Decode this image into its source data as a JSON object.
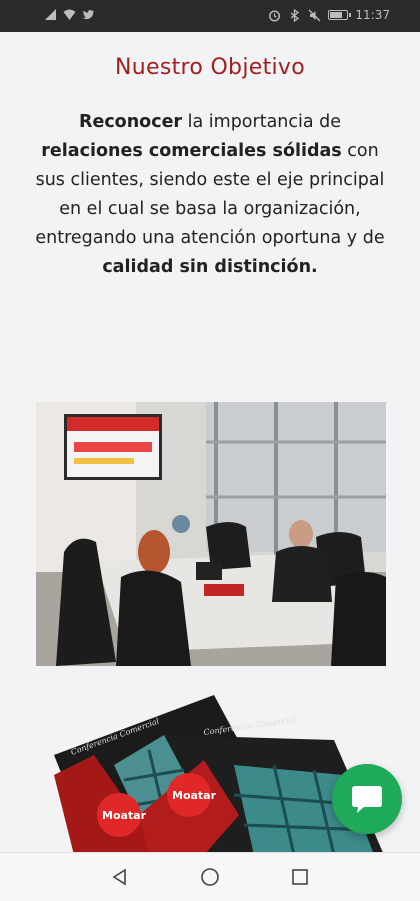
{
  "status_bar": {
    "time": "11:37",
    "left_icons": [
      "signal-icon",
      "wifi-icon",
      "twitter-icon"
    ],
    "right_icons": [
      "alarm-icon",
      "bluetooth-icon",
      "mute-icon",
      "battery-icon"
    ],
    "battery_level": 0.8
  },
  "section": {
    "title": "Nuestro Objetivo",
    "paragraph": [
      {
        "text": "Reconocer",
        "bold": true
      },
      {
        "text": " la importancia de ",
        "bold": false
      },
      {
        "text": "relaciones comerciales sólidas",
        "bold": true
      },
      {
        "text": " con sus clientes, siendo este el eje principal en el cual se basa la organización, entregando una atención oportuna y de ",
        "bold": false
      },
      {
        "text": "calidad sin distinción.",
        "bold": true
      }
    ]
  },
  "images": {
    "meeting_photo": "meeting-room-photo",
    "cards_image": "cards-image",
    "card_brand": "Moatar",
    "card_script": "Conferencia Comercial"
  },
  "chat_button": {
    "icon": "chat-bubble-icon",
    "color": "#1fa95a"
  },
  "nav_bar": {
    "items": [
      {
        "name": "back",
        "icon": "back-triangle-icon"
      },
      {
        "name": "home",
        "icon": "home-circle-icon"
      },
      {
        "name": "recents",
        "icon": "recents-square-icon"
      }
    ]
  },
  "colors": {
    "title": "#a31f1f",
    "background": "#f2f3f5"
  }
}
